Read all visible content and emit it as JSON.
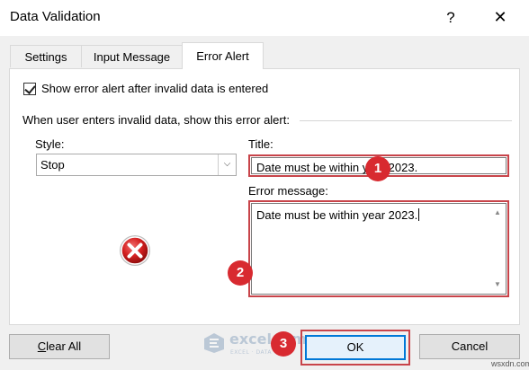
{
  "window": {
    "title": "Data Validation",
    "help_label": "?",
    "close_label": "✕"
  },
  "tabs": [
    {
      "label": "Settings",
      "active": false
    },
    {
      "label": "Input Message",
      "active": false
    },
    {
      "label": "Error Alert",
      "active": true
    }
  ],
  "error_alert": {
    "show_checkbox_label": "Show error alert after invalid data is entered",
    "show_checkbox_checked": true,
    "section_label": "When user enters invalid data, show this error alert:",
    "style_label": "Style:",
    "style_value": "Stop",
    "style_icon": "stop-error-icon",
    "title_label": "Title:",
    "title_value": "Date must be within year 2023.",
    "message_label": "Error message:",
    "message_value": "Date must be within year 2023."
  },
  "annotations": {
    "badge_1": "1",
    "badge_2": "2",
    "badge_3": "3",
    "color": "#d82a30"
  },
  "buttons": {
    "clear_all": "Clear All",
    "ok": "OK",
    "cancel": "Cancel"
  },
  "watermark": {
    "name": "exceldemy",
    "tagline": "EXCEL · DATA · BI"
  },
  "site_mark": "wsxdn.com"
}
